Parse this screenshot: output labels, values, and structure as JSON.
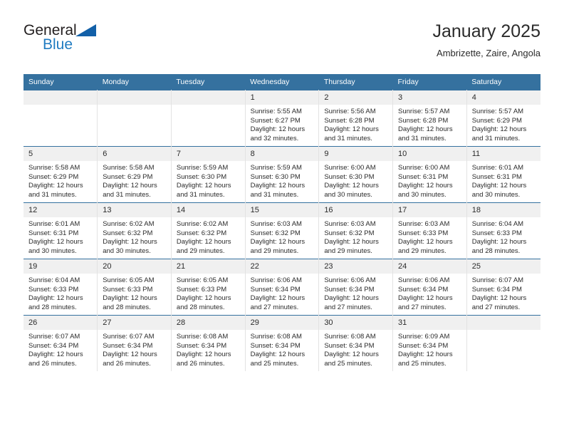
{
  "brand": {
    "name_part1": "General",
    "name_part2": "Blue",
    "logo_icon": "triangle-logo-icon"
  },
  "header": {
    "title": "January 2025",
    "subtitle": "Ambrizette, Zaire, Angola"
  },
  "colors": {
    "header_blue": "#35719f",
    "brand_blue": "#1f7bc1",
    "daynum_bg": "#f0f0f0",
    "cell_border": "#e3e3e3",
    "text": "#2b2b2b"
  },
  "calendar": {
    "weekday_headers": [
      "Sunday",
      "Monday",
      "Tuesday",
      "Wednesday",
      "Thursday",
      "Friday",
      "Saturday"
    ],
    "weeks": [
      [
        {
          "day": "",
          "empty": true
        },
        {
          "day": "",
          "empty": true
        },
        {
          "day": "",
          "empty": true
        },
        {
          "day": "1",
          "sunrise": "Sunrise: 5:55 AM",
          "sunset": "Sunset: 6:27 PM",
          "daylight": "Daylight: 12 hours and 32 minutes."
        },
        {
          "day": "2",
          "sunrise": "Sunrise: 5:56 AM",
          "sunset": "Sunset: 6:28 PM",
          "daylight": "Daylight: 12 hours and 31 minutes."
        },
        {
          "day": "3",
          "sunrise": "Sunrise: 5:57 AM",
          "sunset": "Sunset: 6:28 PM",
          "daylight": "Daylight: 12 hours and 31 minutes."
        },
        {
          "day": "4",
          "sunrise": "Sunrise: 5:57 AM",
          "sunset": "Sunset: 6:29 PM",
          "daylight": "Daylight: 12 hours and 31 minutes."
        }
      ],
      [
        {
          "day": "5",
          "sunrise": "Sunrise: 5:58 AM",
          "sunset": "Sunset: 6:29 PM",
          "daylight": "Daylight: 12 hours and 31 minutes."
        },
        {
          "day": "6",
          "sunrise": "Sunrise: 5:58 AM",
          "sunset": "Sunset: 6:29 PM",
          "daylight": "Daylight: 12 hours and 31 minutes."
        },
        {
          "day": "7",
          "sunrise": "Sunrise: 5:59 AM",
          "sunset": "Sunset: 6:30 PM",
          "daylight": "Daylight: 12 hours and 31 minutes."
        },
        {
          "day": "8",
          "sunrise": "Sunrise: 5:59 AM",
          "sunset": "Sunset: 6:30 PM",
          "daylight": "Daylight: 12 hours and 31 minutes."
        },
        {
          "day": "9",
          "sunrise": "Sunrise: 6:00 AM",
          "sunset": "Sunset: 6:30 PM",
          "daylight": "Daylight: 12 hours and 30 minutes."
        },
        {
          "day": "10",
          "sunrise": "Sunrise: 6:00 AM",
          "sunset": "Sunset: 6:31 PM",
          "daylight": "Daylight: 12 hours and 30 minutes."
        },
        {
          "day": "11",
          "sunrise": "Sunrise: 6:01 AM",
          "sunset": "Sunset: 6:31 PM",
          "daylight": "Daylight: 12 hours and 30 minutes."
        }
      ],
      [
        {
          "day": "12",
          "sunrise": "Sunrise: 6:01 AM",
          "sunset": "Sunset: 6:31 PM",
          "daylight": "Daylight: 12 hours and 30 minutes."
        },
        {
          "day": "13",
          "sunrise": "Sunrise: 6:02 AM",
          "sunset": "Sunset: 6:32 PM",
          "daylight": "Daylight: 12 hours and 30 minutes."
        },
        {
          "day": "14",
          "sunrise": "Sunrise: 6:02 AM",
          "sunset": "Sunset: 6:32 PM",
          "daylight": "Daylight: 12 hours and 29 minutes."
        },
        {
          "day": "15",
          "sunrise": "Sunrise: 6:03 AM",
          "sunset": "Sunset: 6:32 PM",
          "daylight": "Daylight: 12 hours and 29 minutes."
        },
        {
          "day": "16",
          "sunrise": "Sunrise: 6:03 AM",
          "sunset": "Sunset: 6:32 PM",
          "daylight": "Daylight: 12 hours and 29 minutes."
        },
        {
          "day": "17",
          "sunrise": "Sunrise: 6:03 AM",
          "sunset": "Sunset: 6:33 PM",
          "daylight": "Daylight: 12 hours and 29 minutes."
        },
        {
          "day": "18",
          "sunrise": "Sunrise: 6:04 AM",
          "sunset": "Sunset: 6:33 PM",
          "daylight": "Daylight: 12 hours and 28 minutes."
        }
      ],
      [
        {
          "day": "19",
          "sunrise": "Sunrise: 6:04 AM",
          "sunset": "Sunset: 6:33 PM",
          "daylight": "Daylight: 12 hours and 28 minutes."
        },
        {
          "day": "20",
          "sunrise": "Sunrise: 6:05 AM",
          "sunset": "Sunset: 6:33 PM",
          "daylight": "Daylight: 12 hours and 28 minutes."
        },
        {
          "day": "21",
          "sunrise": "Sunrise: 6:05 AM",
          "sunset": "Sunset: 6:33 PM",
          "daylight": "Daylight: 12 hours and 28 minutes."
        },
        {
          "day": "22",
          "sunrise": "Sunrise: 6:06 AM",
          "sunset": "Sunset: 6:34 PM",
          "daylight": "Daylight: 12 hours and 27 minutes."
        },
        {
          "day": "23",
          "sunrise": "Sunrise: 6:06 AM",
          "sunset": "Sunset: 6:34 PM",
          "daylight": "Daylight: 12 hours and 27 minutes."
        },
        {
          "day": "24",
          "sunrise": "Sunrise: 6:06 AM",
          "sunset": "Sunset: 6:34 PM",
          "daylight": "Daylight: 12 hours and 27 minutes."
        },
        {
          "day": "25",
          "sunrise": "Sunrise: 6:07 AM",
          "sunset": "Sunset: 6:34 PM",
          "daylight": "Daylight: 12 hours and 27 minutes."
        }
      ],
      [
        {
          "day": "26",
          "sunrise": "Sunrise: 6:07 AM",
          "sunset": "Sunset: 6:34 PM",
          "daylight": "Daylight: 12 hours and 26 minutes."
        },
        {
          "day": "27",
          "sunrise": "Sunrise: 6:07 AM",
          "sunset": "Sunset: 6:34 PM",
          "daylight": "Daylight: 12 hours and 26 minutes."
        },
        {
          "day": "28",
          "sunrise": "Sunrise: 6:08 AM",
          "sunset": "Sunset: 6:34 PM",
          "daylight": "Daylight: 12 hours and 26 minutes."
        },
        {
          "day": "29",
          "sunrise": "Sunrise: 6:08 AM",
          "sunset": "Sunset: 6:34 PM",
          "daylight": "Daylight: 12 hours and 25 minutes."
        },
        {
          "day": "30",
          "sunrise": "Sunrise: 6:08 AM",
          "sunset": "Sunset: 6:34 PM",
          "daylight": "Daylight: 12 hours and 25 minutes."
        },
        {
          "day": "31",
          "sunrise": "Sunrise: 6:09 AM",
          "sunset": "Sunset: 6:34 PM",
          "daylight": "Daylight: 12 hours and 25 minutes."
        },
        {
          "day": "",
          "empty": true
        }
      ]
    ]
  }
}
